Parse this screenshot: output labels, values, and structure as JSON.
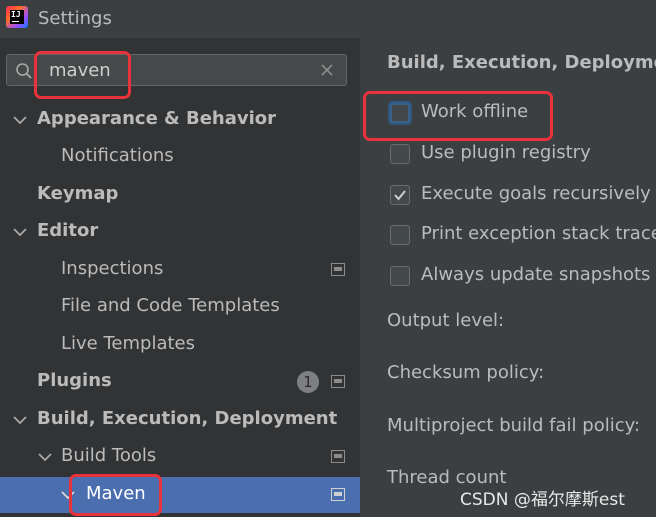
{
  "window": {
    "title": "Settings"
  },
  "search": {
    "value": "maven"
  },
  "sidebar": {
    "items": [
      {
        "label": "Appearance & Behavior"
      },
      {
        "label": "Notifications"
      },
      {
        "label": "Keymap"
      },
      {
        "label": "Editor"
      },
      {
        "label": "Inspections"
      },
      {
        "label": "File and Code Templates"
      },
      {
        "label": "Live Templates"
      },
      {
        "label": "Plugins",
        "badge": "1"
      },
      {
        "label": "Build, Execution, Deployment"
      },
      {
        "label": "Build Tools"
      },
      {
        "label": "Maven"
      }
    ],
    "selected": "Maven"
  },
  "content": {
    "section_title": "Build, Execution, Deployment",
    "options": [
      {
        "label": "Work offline",
        "checked": false
      },
      {
        "label": "Use plugin registry",
        "checked": false
      },
      {
        "label": "Execute goals recursively",
        "checked": true
      },
      {
        "label": "Print exception stack traces",
        "checked": false
      },
      {
        "label": "Always update snapshots",
        "checked": false
      }
    ],
    "fields": [
      {
        "label": "Output level:"
      },
      {
        "label": "Checksum policy:"
      },
      {
        "label": "Multiproject build fail policy:"
      },
      {
        "label": "Thread count"
      }
    ]
  },
  "watermark": "CSDN @福尔摩斯est",
  "colors": {
    "selection": "#4b6eaf",
    "highlight_box": "#e8323c",
    "background": "#3c3f41",
    "sidebar": "#313335"
  }
}
